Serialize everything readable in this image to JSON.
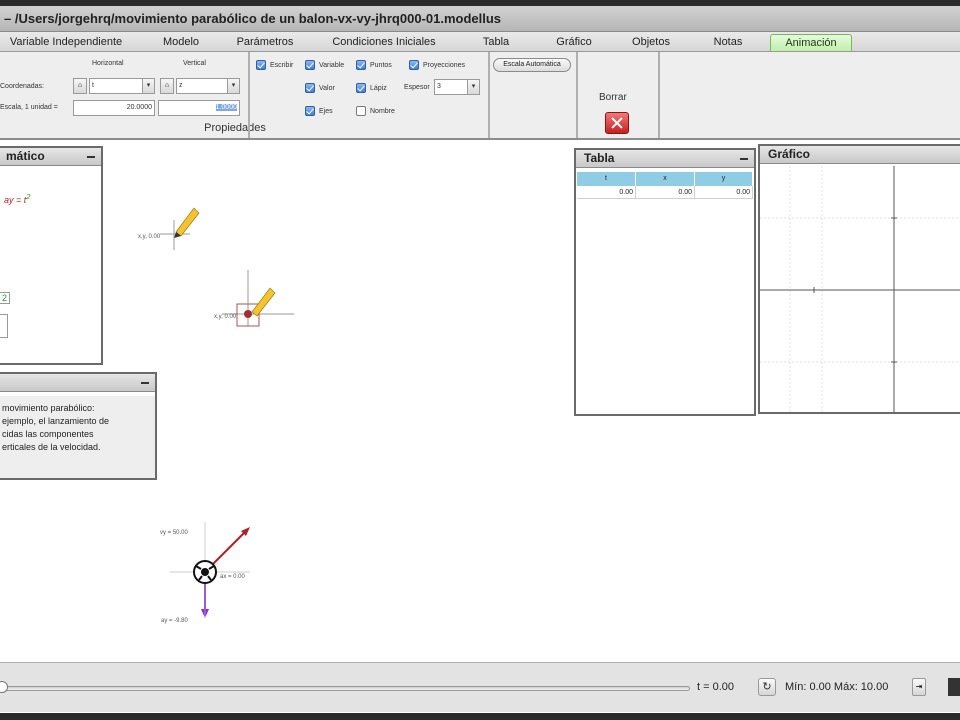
{
  "window": {
    "title": "– /Users/jorgehrq/movimiento parabólico de un balon-vx-vy-jhrq000-01.modellus"
  },
  "tabs": [
    {
      "label": "Variable Independiente"
    },
    {
      "label": "Modelo"
    },
    {
      "label": "Parámetros"
    },
    {
      "label": "Condiciones Iniciales"
    },
    {
      "label": "Tabla"
    },
    {
      "label": "Gráfico"
    },
    {
      "label": "Objetos"
    },
    {
      "label": "Notas"
    },
    {
      "label": "Animación"
    }
  ],
  "ribbon": {
    "horizontal_label": "Horizontal",
    "vertical_label": "Vertical",
    "coordenadas_label": "Coordenadas:",
    "horizontal_select": "t",
    "vertical_select": "z",
    "escala_label": "Escala, 1 unidad =",
    "escala_h_value": "20.0000",
    "escala_v_value": "1.0000",
    "section_title": "Propiedades",
    "check_escribir": "Escribir",
    "check_variable": "Variable",
    "check_puntos": "Puntos",
    "check_proyecciones": "Proyecciones",
    "check_valor": "Valor",
    "check_lapiz": "Lápiz",
    "espesor_label": "Espesor",
    "espesor_value": "3",
    "check_ejes": "Ejes",
    "check_nombre": "Nombre",
    "escala_automatica": "Escala Automática",
    "borrar_label": "Borrar"
  },
  "panels": {
    "modelo_title": "mático",
    "modelo_eq": "ay = t",
    "modelo_exp": "2",
    "modelo_frag1": "2",
    "notas_title": "",
    "notas_lines": [
      "movimiento parabólico:",
      "ejemplo, el lanzamiento de",
      "cidas las componentes",
      "erticales de la velocidad."
    ],
    "tabla_title": "Tabla",
    "tabla_columns": [
      "t",
      "x",
      "y"
    ],
    "tabla_rows": [
      [
        "0.00",
        "0.00",
        "0.00"
      ]
    ],
    "grafico_title": "Gráfico"
  },
  "canvas": {
    "vx_label": "vy = 50.00",
    "ay_label": "ay = -9.80",
    "side_label": "ax = 0.00",
    "small_label": "x,y, 0.00"
  },
  "bottom": {
    "t_label": "t = 0.00",
    "min_max_label": "Mín: 0.00 Máx: 10.00",
    "slider_progress": 0
  },
  "colors": {
    "active_tab": "#bff0a9",
    "table_header": "#8ecde3",
    "vector_red": "#b0202a",
    "vector_purple": "#8a2be2"
  }
}
